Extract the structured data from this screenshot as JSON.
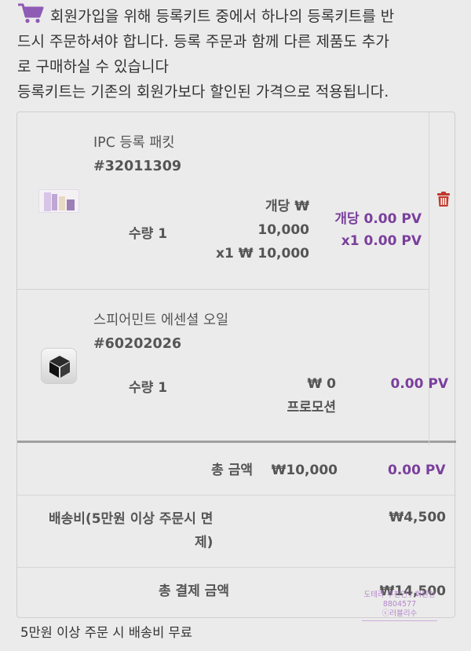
{
  "notice": {
    "line1": "회원가입을 위해 등록키트 중에서 하나의 등록키트를 반",
    "line2": "드시 주문하셔야 합니다. 등록 주문과 함께 다른 제품도 추가",
    "line3": "로 구매하실 수 있습니다",
    "line4": "등록키트는 기존의 회원가보다 할인된 가격으로 적용됩니다."
  },
  "items": [
    {
      "name": "IPC 등록 패킷",
      "code": "#32011309",
      "quantity_label": "수량 1",
      "unit_label": "개당 ₩",
      "unit_price": "10,000",
      "line_total": "x1 ₩ 10,000",
      "unit_pv": "개당 0.00 PV",
      "line_pv": "x1 0.00 PV"
    },
    {
      "name": "스피어민트 에센셜 오일",
      "code": "#60202026",
      "quantity_label": "수량 1",
      "price": "₩ 0",
      "promo_label": "프로모션",
      "pv": "0.00 PV"
    }
  ],
  "summary": {
    "total_label": "총 금액",
    "total_value": "₩10,000",
    "total_pv": "0.00 PV",
    "shipping_label_line1": "배송비(5만원 이상 주문시 면",
    "shipping_label_line2": "제)",
    "shipping_value": "₩4,500",
    "payment_label": "총 결제 금액",
    "payment_value": "₩14,500"
  },
  "footer_note": "5만원 이상 주문 시 배송비 무료",
  "watermark": {
    "line1": "도테라 추천인 / 회원인",
    "line2": "8804577",
    "line3": "ⓒ러블리수"
  },
  "colors": {
    "accent": "#7a3f9c",
    "danger": "#c0392b",
    "cart": "#8e5bb5"
  }
}
